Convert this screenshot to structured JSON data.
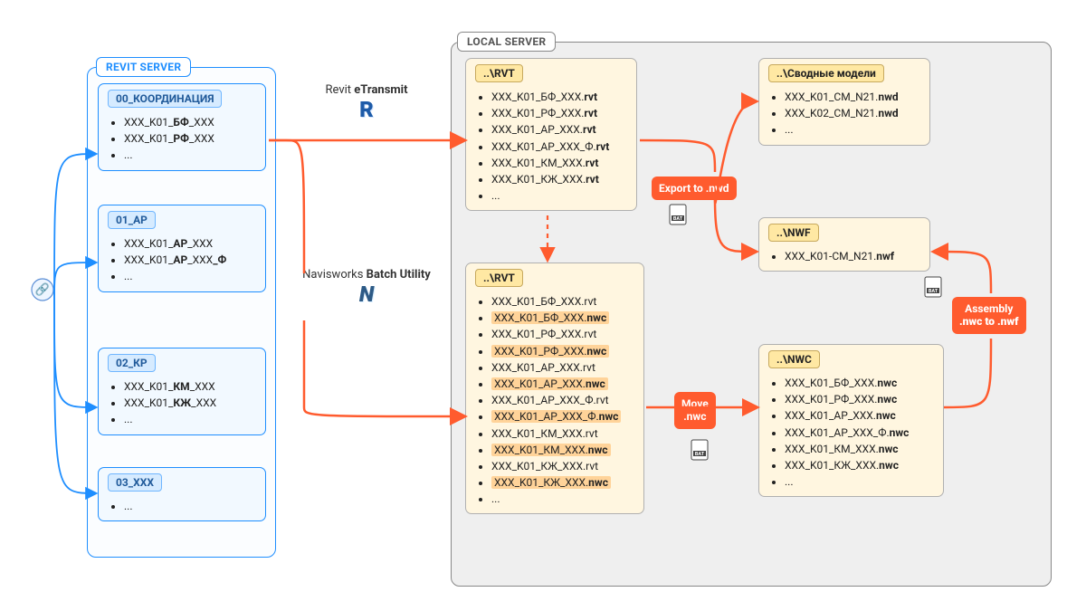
{
  "regions": {
    "revit": "REVIT SERVER",
    "local": "LOCAL SERVER"
  },
  "labels": {
    "etransmit_pre": "Revit ",
    "etransmit_bold": "eTransmit",
    "batch_pre": "Navisworks ",
    "batch_bold": "Batch Utility"
  },
  "actions": {
    "export": "Export to .nwd",
    "move_l1": "Move",
    "move_l2": ".nwc",
    "asm_l1": "Assembly",
    "asm_l2": ".nwc to .nwf"
  },
  "revit": {
    "coord": {
      "hdr": "00_КООРДИНАЦИЯ",
      "items": [
        "XXX_K01_<b>БФ</b>_XXX",
        "XXX_K01_<b>РФ</b>_XXX",
        "..."
      ]
    },
    "ar": {
      "hdr": "01_АР",
      "items": [
        "XXX_K01_<b>АР</b>_XXX",
        "XXX_K01_<b>АР</b>_XXX<b>_Ф</b>",
        "..."
      ]
    },
    "kr": {
      "hdr": "02_КР",
      "items": [
        "XXX_K01_<b>КМ</b>_XXX",
        "XXX_K01_<b>КЖ</b>_XXX",
        "..."
      ]
    },
    "xxx": {
      "hdr": "03_XXX",
      "items": [
        "..."
      ]
    }
  },
  "local": {
    "rvt1": {
      "hdr": "..\\RVT",
      "items": [
        "XXX_K01_БФ_XXX.<b>rvt</b>",
        "XXX_K01_РФ_XXX.<b>rvt</b>",
        "XXX_K01_АР_XXX.<b>rvt</b>",
        "XXX_K01_АР_XXX_Ф.<b>rvt</b>",
        "XXX_K01_КМ_XXX.<b>rvt</b>",
        "XXX_K01_КЖ_XXX.<b>rvt</b>",
        "..."
      ]
    },
    "rvt2": {
      "hdr": "..\\RVT",
      "items": [
        "XXX_K01_БФ_XXX.rvt",
        "<span class='hl'>XXX_K01_БФ_XXX.<b>nwc</b></span>",
        "XXX_K01_РФ_XXX.rvt",
        "<span class='hl'>XXX_K01_РФ_XXX.<b>nwc</b></span>",
        "XXX_K01_АР_XXX.rvt",
        "<span class='hl'>XXX_K01_АР_XXX.<b>nwc</b></span>",
        "XXX_K01_АР_XXX_Ф.rvt",
        "<span class='hl'>XXX_K01_АР_XXX_Ф.<b>nwc</b></span>",
        "XXX_K01_КМ_XXX.rvt",
        "<span class='hl'>XXX_K01_КМ_XXX.<b>nwc</b></span>",
        "XXX_K01_КЖ_XXX.rvt",
        "<span class='hl'>XXX_K01_КЖ_XXX.<b>nwc</b></span>",
        "..."
      ]
    },
    "svod": {
      "hdr": "..\\Сводные модели",
      "items": [
        "XXX_K01_CM_N21.<b>nwd</b>",
        "XXX_K02_CM_N21.<b>nwd</b>",
        "..."
      ]
    },
    "nwf": {
      "hdr": "..\\NWF",
      "items": [
        "XXX_K01-CM_N21.<b>nwf</b>"
      ]
    },
    "nwc": {
      "hdr": "..\\NWC",
      "items": [
        "XXX_K01_БФ_XXX.<b>nwc</b>",
        "XXX_K01_РФ_XXX.<b>nwc</b>",
        "XXX_K01_АР_XXX.<b>nwc</b>",
        "XXX_K01_АР_XXX_Ф.<b>nwc</b>",
        "XXX_K01_КМ_XXX.<b>nwc</b>",
        "XXX_K01_КЖ_XXX.<b>nwc</b>",
        "..."
      ]
    }
  }
}
